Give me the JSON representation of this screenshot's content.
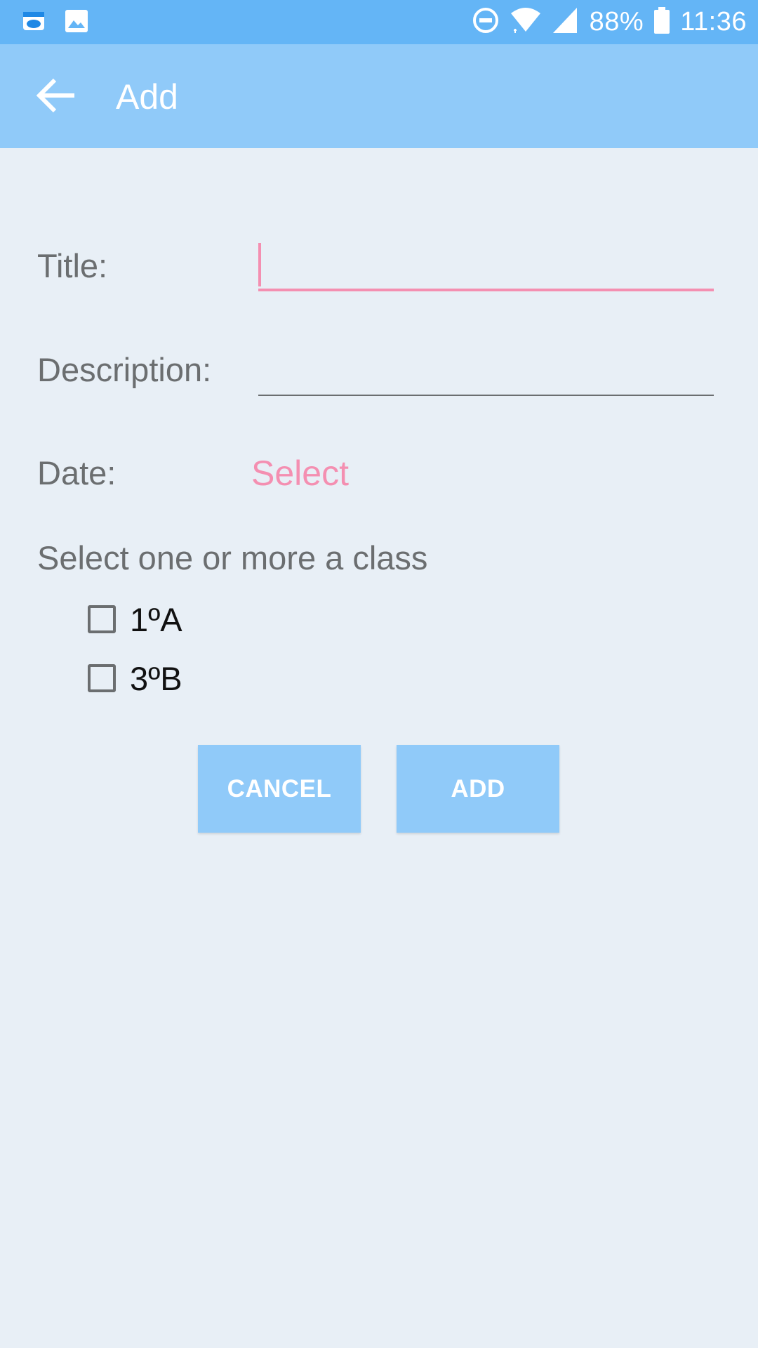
{
  "status_bar": {
    "battery": "88%",
    "time": "11:36",
    "icons": [
      "app-notification-icon",
      "image-notification-icon",
      "do-not-disturb-icon",
      "wifi-icon",
      "cell-signal-icon",
      "battery-icon"
    ]
  },
  "app_bar": {
    "title": "Add",
    "back_icon": "arrow-back-icon"
  },
  "form": {
    "title_label": "Title:",
    "title_value": "",
    "description_label": "Description:",
    "description_value": "",
    "date_label": "Date:",
    "date_select": "Select",
    "class_section_label": "Select one or more a class",
    "classes": [
      {
        "label": "1ºA",
        "checked": false
      },
      {
        "label": "3ºB",
        "checked": false
      }
    ]
  },
  "buttons": {
    "cancel": "CANCEL",
    "add": "ADD"
  },
  "colors": {
    "status_bar": "#64b5f6",
    "app_bar": "#90caf9",
    "background": "#e8eff6",
    "accent": "#f48fb1",
    "button": "#90caf9",
    "label_text": "#6b6e70"
  }
}
